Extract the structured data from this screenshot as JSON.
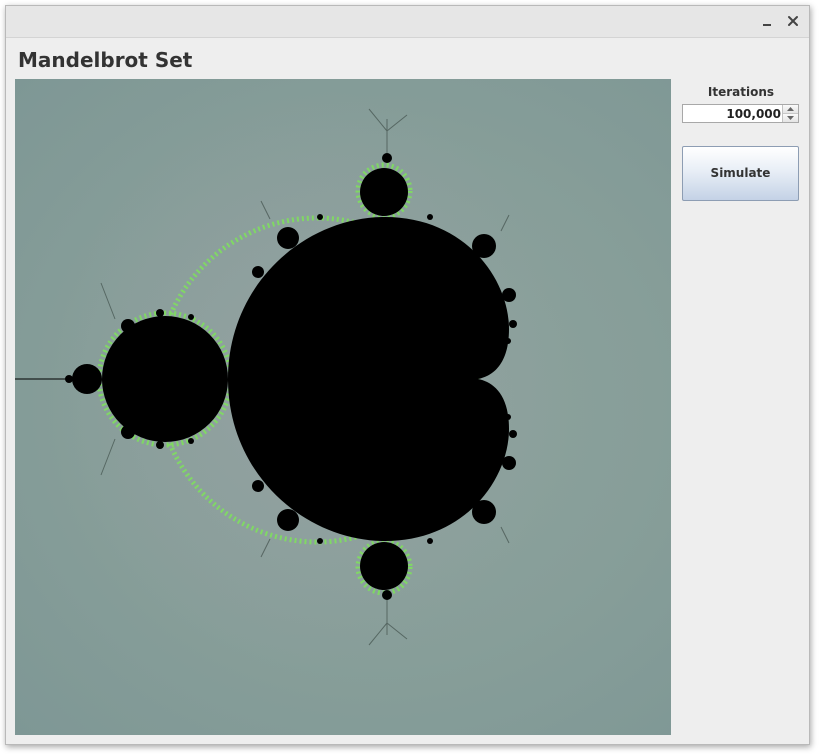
{
  "window": {
    "controls": {
      "minimize_icon": "minimize-icon",
      "close_icon": "close-icon"
    }
  },
  "page": {
    "title": "Mandelbrot Set"
  },
  "controls": {
    "iterations_label": "Iterations",
    "iterations_value": "100,000",
    "simulate_label": "Simulate"
  },
  "render": {
    "background_color": "#879e99",
    "set_color": "#000000",
    "edge_color": "#7ee35b",
    "halo_color": "#9a9fa6"
  }
}
